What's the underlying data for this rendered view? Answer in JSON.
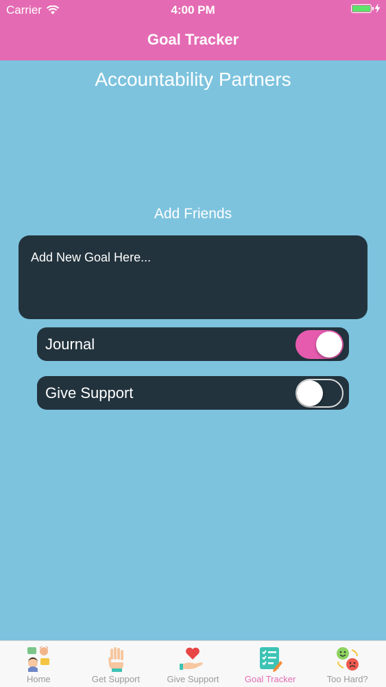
{
  "status_bar": {
    "carrier": "Carrier",
    "time": "4:00 PM",
    "battery_color": "#5DE26A"
  },
  "nav": {
    "title": "Goal Tracker"
  },
  "main": {
    "heading": "Accountability Partners",
    "add_friends": "Add Friends",
    "goal_input": {
      "placeholder": "Add New Goal Here..."
    },
    "toggles": [
      {
        "label": "Journal",
        "on": true
      },
      {
        "label": "Give Support",
        "on": false
      }
    ]
  },
  "tabs": [
    {
      "label": "Home",
      "icon": "people-chat-icon",
      "active": false
    },
    {
      "label": "Get Support",
      "icon": "raised-hand-icon",
      "active": false
    },
    {
      "label": "Give Support",
      "icon": "heart-hand-icon",
      "active": false
    },
    {
      "label": "Goal Tracker",
      "icon": "checklist-icon",
      "active": true
    },
    {
      "label": "Too Hard?",
      "icon": "mood-faces-icon",
      "active": false
    }
  ],
  "colors": {
    "header": "#E46BB3",
    "background": "#7DC3DE",
    "panel": "#22333D",
    "switch_on": "#E65BAE",
    "tab_active": "#E46BB3"
  }
}
